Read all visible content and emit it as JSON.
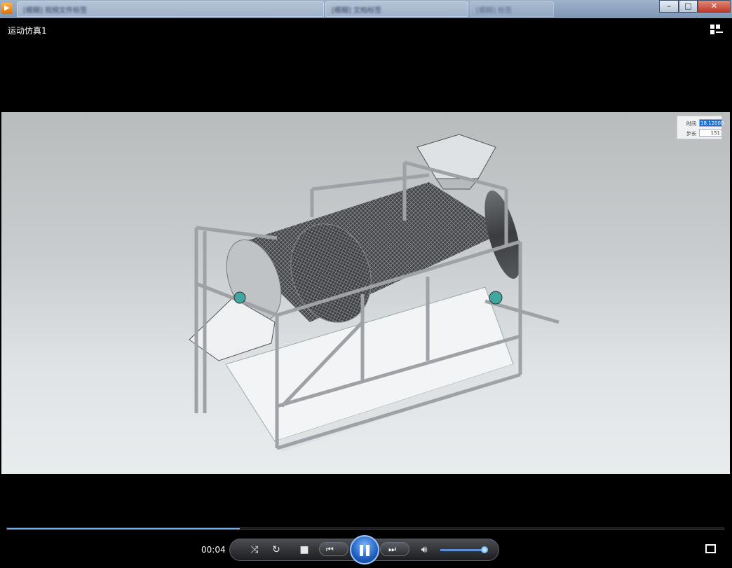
{
  "window": {
    "tabs": [
      {
        "label": "[模糊] 视频文件标签"
      },
      {
        "label": "[模糊] 文档标签"
      },
      {
        "label": "[模糊] 标签"
      }
    ],
    "controls": {
      "minimize": "–",
      "maximize": "□",
      "close": "✕"
    }
  },
  "player": {
    "title": "运动仿真1",
    "sim_panel": {
      "time_label": "时间",
      "time_value": "18.12000",
      "step_label": "步长",
      "step_value": "151"
    },
    "timecode": "00:04",
    "progress": 0.325,
    "volume": 0.9,
    "icons": {
      "shuffle": "shuffle-icon",
      "repeat": "repeat-icon",
      "stop": "stop-icon",
      "prev": "previous-icon",
      "pause": "pause-icon",
      "next": "next-icon",
      "volume": "volume-icon",
      "fullscreen": "fullscreen-icon"
    }
  }
}
